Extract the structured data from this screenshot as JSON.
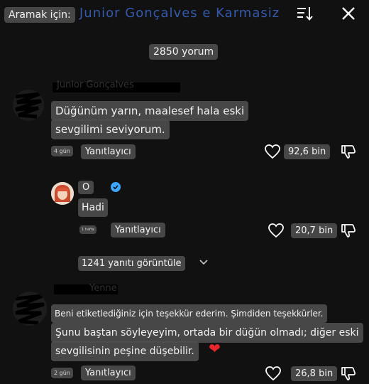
{
  "search": {
    "label": "Aramak için:",
    "query": "Junior Gonçalves e Karmasiz"
  },
  "comments_count": "2850 yorum",
  "comment1": {
    "author": "Junior Gonçalves",
    "line1": "Düğünüm yarın, maalesef hala eski",
    "line2": "sevgilimi seviyorum.",
    "time": "4 gün",
    "reply_label": "Yanıtlayıcı",
    "likes": "92,6 bin"
  },
  "reply1": {
    "author": "O",
    "text": "Hadi",
    "time": "1 hafta",
    "reply_label": "Yanıtlayıcı",
    "likes": "20,7 bin"
  },
  "view_replies": "1241 yanıtı görüntüle",
  "comment2": {
    "author": "Yenne",
    "line1": "Beni etiketlediğiniz için teşekkür ederim. Şimdiden teşekkürler.",
    "line2": "Şunu baştan söyleyeyim, ortada bir düğün olmadı; diğer eski",
    "line3": "sevgilisinin peşine düşebilir.",
    "emoji": "❤",
    "time": "2 gün",
    "reply_label": "Yanıtlayıcı",
    "likes": "26,8 bin"
  },
  "colors": {
    "background": "#111111",
    "highlight": "#4e4e4e",
    "verified": "#3ea6ff",
    "heart": "#e8262c"
  },
  "icons": [
    "sort-icon",
    "close-icon",
    "heart-outline-icon",
    "thumbs-down-icon",
    "verified-badge-icon",
    "chevron-down-icon"
  ]
}
